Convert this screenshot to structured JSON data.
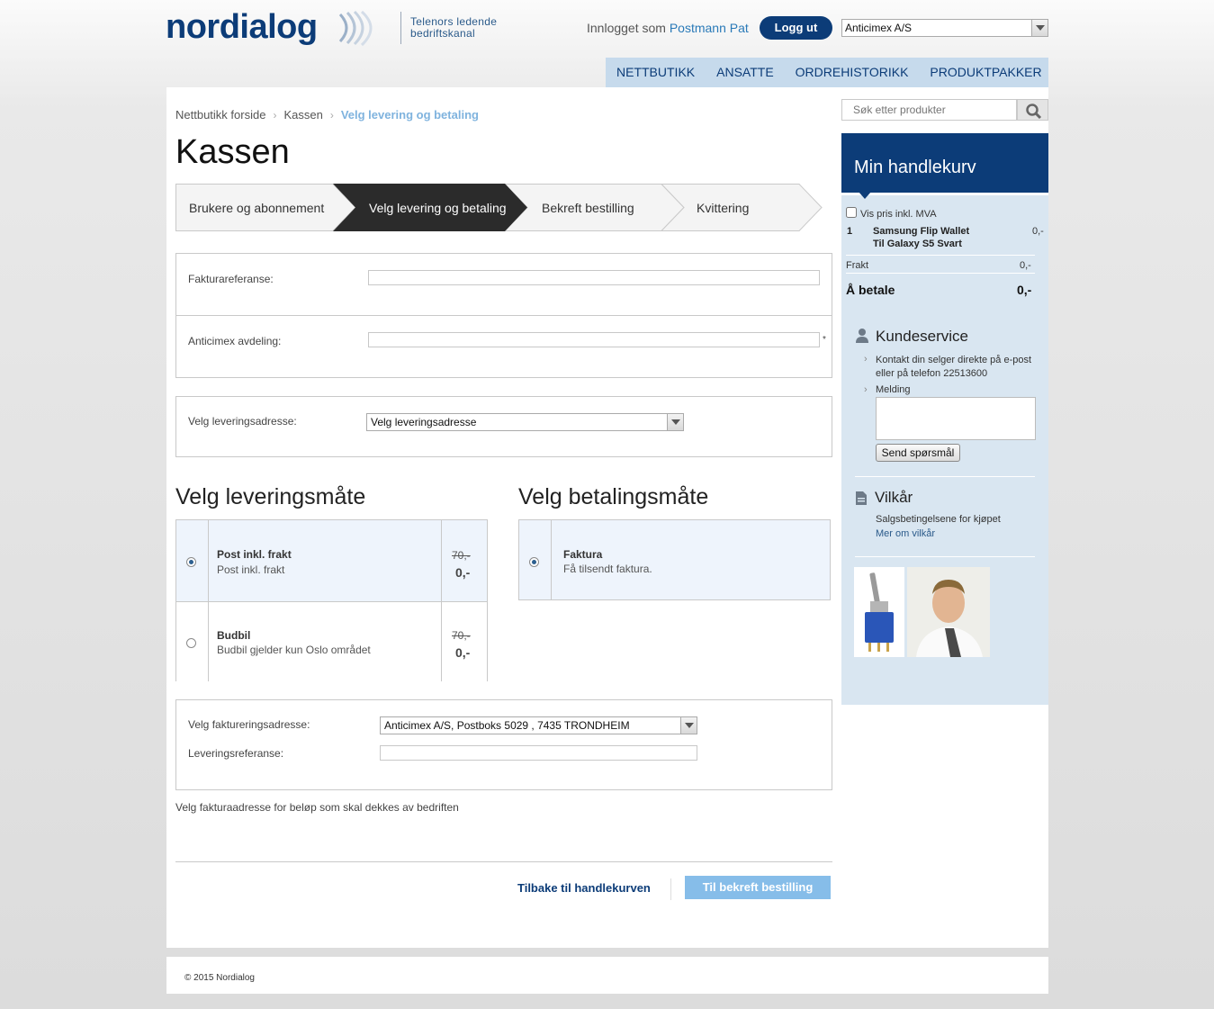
{
  "header": {
    "logo_text": "nordialog",
    "tagline_line1": "Telenors ledende",
    "tagline_line2": "bedriftskanal",
    "logged_in_prefix": "Innlogget som",
    "user_name": "Postmann Pat",
    "logout_label": "Logg ut",
    "company_selected": "Anticimex A/S"
  },
  "nav": [
    "NETTBUTIKK",
    "ANSATTE",
    "ORDREHISTORIKK",
    "PRODUKTPAKKER"
  ],
  "breadcrumb": [
    "Nettbutikk forside",
    "Kassen",
    "Velg levering og betaling"
  ],
  "page_title": "Kassen",
  "steps": [
    "Brukere og abonnement",
    "Velg levering og betaling",
    "Bekreft bestilling",
    "Kvittering"
  ],
  "invoice_form": {
    "invoice_ref_label": "Fakturareferanse:",
    "invoice_ref_value": "",
    "department_label": "Anticimex avdeling:",
    "department_value": "",
    "required_mark": "*"
  },
  "delivery_address": {
    "label": "Velg leveringsadresse:",
    "selected": "Velg leveringsadresse"
  },
  "delivery_method": {
    "title": "Velg leveringsmåte",
    "options": [
      {
        "title": "Post inkl. frakt",
        "desc": "Post inkl. frakt",
        "old_price": "70,-",
        "price": "0,-",
        "selected": true
      },
      {
        "title": "Budbil",
        "desc": "Budbil gjelder kun Oslo området",
        "old_price": "70,-",
        "price": "0,-",
        "selected": false
      }
    ]
  },
  "payment_method": {
    "title": "Velg betalingsmåte",
    "options": [
      {
        "title": "Faktura",
        "desc": "Få tilsendt faktura.",
        "selected": true
      }
    ]
  },
  "billing": {
    "address_label": "Velg faktureringsadresse:",
    "address_selected": "Anticimex A/S, Postboks 5029 , 7435 TRONDHEIM",
    "delivery_ref_label": "Leveringsreferanse:",
    "delivery_ref_value": ""
  },
  "billing_note": "Velg fakturaadresse for beløp som skal dekkes av bedriften",
  "actions": {
    "back_label": "Tilbake til handlekurven",
    "next_label": "Til bekreft bestilling"
  },
  "sidebar": {
    "search_placeholder": "Søk etter produkter",
    "cart_title": "Min handlekurv",
    "vat_label": "Vis pris inkl. MVA",
    "cart_items": [
      {
        "qty": "1",
        "name_line1": "Samsung Flip Wallet",
        "name_line2": "Til Galaxy S5 Svart",
        "price": "0,-"
      }
    ],
    "shipping_label": "Frakt",
    "shipping_value": "0,-",
    "total_label": "Å betale",
    "total_value": "0,-",
    "customer_service_title": "Kundeservice",
    "contact_line1": "Kontakt din selger direkte på e-post",
    "contact_line2": "eller på telefon 22513600",
    "message_label": "Melding",
    "send_label": "Send spørsmål",
    "terms_title": "Vilkår",
    "terms_text": "Salgsbetingelsene for kjøpet",
    "terms_link": "Mer om vilkår"
  },
  "footer": "© 2015 Nordialog",
  "colors": {
    "brand_navy": "#0c3c78",
    "nav_bg": "#c6daec",
    "sidebar_bg": "#d9e6f1",
    "next_button": "#86bde9",
    "selected_option_bg": "#eef4fc"
  },
  "icons": [
    "search-icon",
    "person-icon",
    "document-icon",
    "chevron-right-icon",
    "dropdown-arrow-icon",
    "radio-icon"
  ]
}
